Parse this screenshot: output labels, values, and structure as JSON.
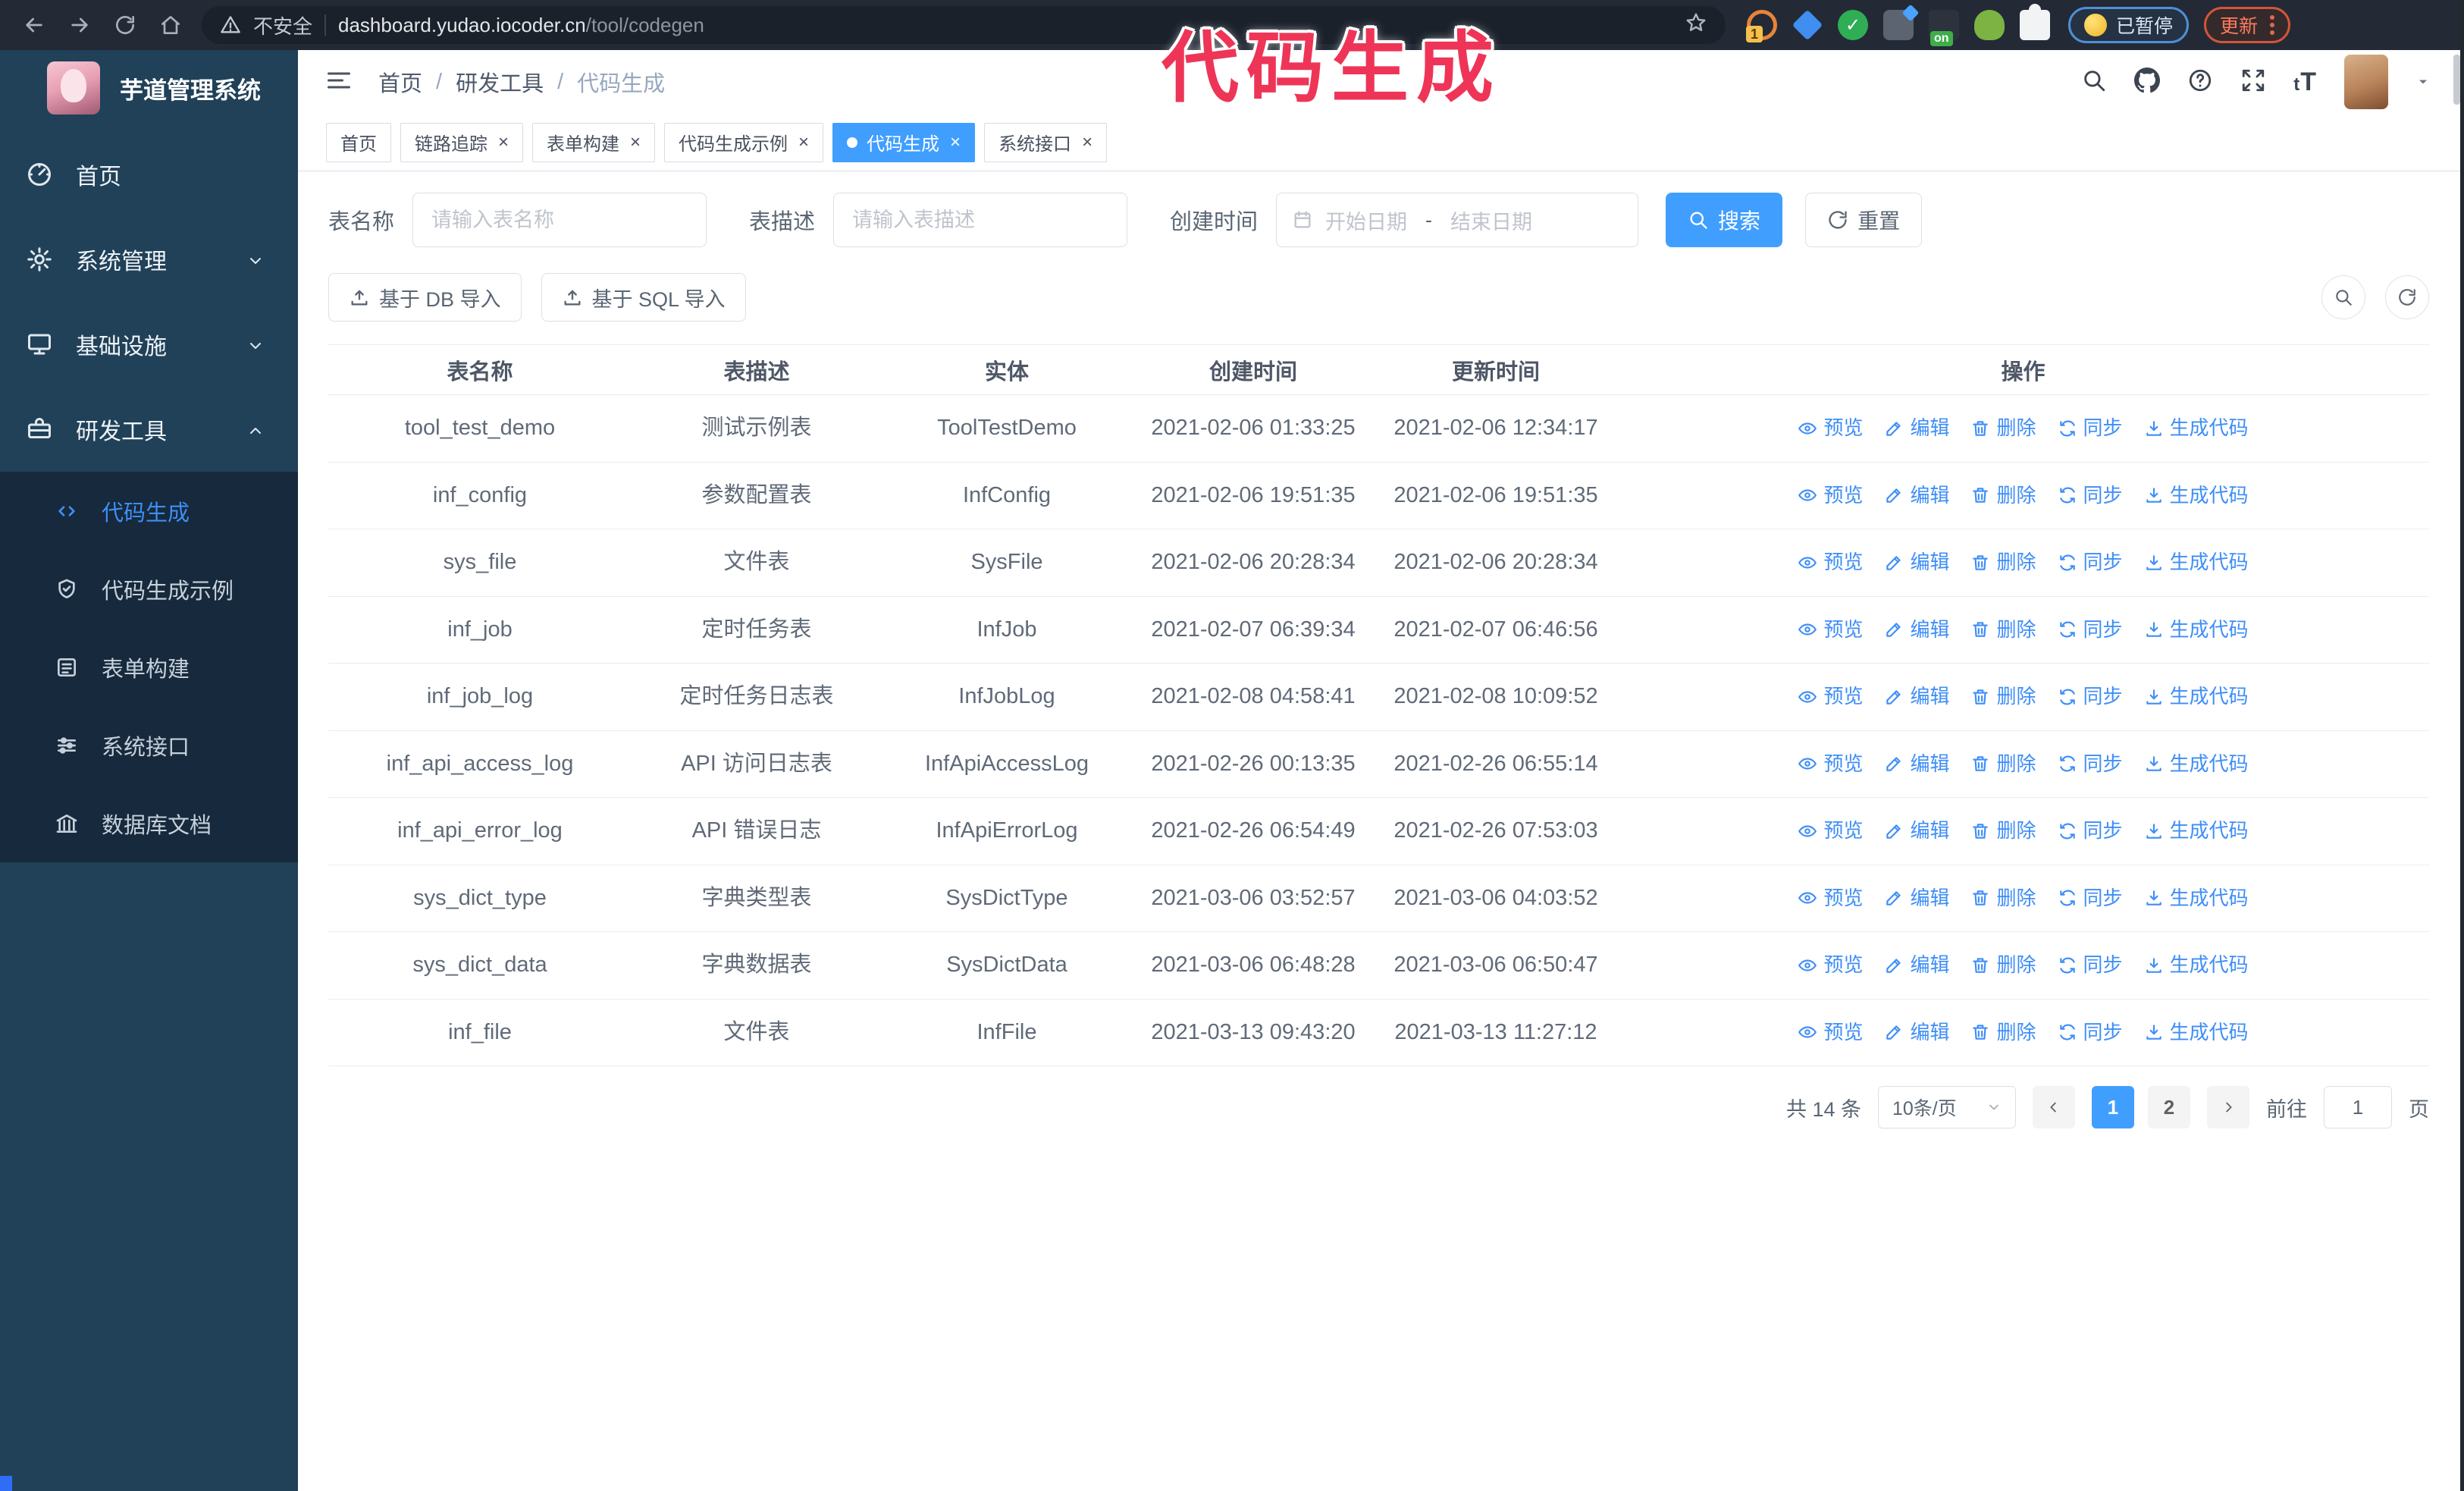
{
  "colors": {
    "accent": "#409eff",
    "annotation": "#ee3557",
    "sidebar_bg": "#204158",
    "submenu_bg": "#17293c",
    "update_accent": "#ff7a5c",
    "paused_border": "#4f8fd6"
  },
  "annotation": {
    "text": "代码生成"
  },
  "browser": {
    "security_label": "不安全",
    "url_host": "dashboard.yudao.iocoder.cn",
    "url_path": "/tool/codegen",
    "paused_label": "已暂停",
    "update_label": "更新",
    "extensions": [
      {
        "name": "orange-ring-extension",
        "type": "ring",
        "badge": "1"
      },
      {
        "name": "blue-gem-extension",
        "type": "gem"
      },
      {
        "name": "green-check-extension",
        "type": "check",
        "glyph": "✓"
      },
      {
        "name": "grid-extension",
        "type": "grid"
      },
      {
        "name": "screen-on-extension",
        "type": "onsw",
        "badge": "on"
      },
      {
        "name": "green-bot-extension",
        "type": "bot"
      },
      {
        "name": "puzzle-extension",
        "type": "puzzle"
      }
    ]
  },
  "sidebar": {
    "title": "芋道管理系统",
    "menu": [
      {
        "id": "home",
        "label": "首页",
        "icon": "gauge",
        "chevron": null,
        "active": false
      },
      {
        "id": "system",
        "label": "系统管理",
        "icon": "gear",
        "chevron": "down",
        "active": false
      },
      {
        "id": "infra",
        "label": "基础设施",
        "icon": "monitor",
        "chevron": "down",
        "active": false
      },
      {
        "id": "devtools",
        "label": "研发工具",
        "icon": "toolbox",
        "chevron": "up",
        "active": true
      }
    ],
    "submenu": [
      {
        "id": "codegen",
        "label": "代码生成",
        "icon": "code",
        "active": true
      },
      {
        "id": "codegen-example",
        "label": "代码生成示例",
        "icon": "shield",
        "active": false
      },
      {
        "id": "form-builder",
        "label": "表单构建",
        "icon": "form",
        "active": false
      },
      {
        "id": "system-api",
        "label": "系统接口",
        "icon": "sliders",
        "active": false
      },
      {
        "id": "db-doc",
        "label": "数据库文档",
        "icon": "db",
        "active": false
      }
    ]
  },
  "navbar": {
    "breadcrumb": [
      "首页",
      "研发工具",
      "代码生成"
    ],
    "separator": "/"
  },
  "tabs": [
    {
      "id": "home",
      "label": "首页",
      "closable": false,
      "active": false
    },
    {
      "id": "tracing",
      "label": "链路追踪",
      "closable": true,
      "active": false
    },
    {
      "id": "form-builder",
      "label": "表单构建",
      "closable": true,
      "active": false
    },
    {
      "id": "codegen-example",
      "label": "代码生成示例",
      "closable": true,
      "active": false
    },
    {
      "id": "codegen",
      "label": "代码生成",
      "closable": true,
      "active": true
    },
    {
      "id": "system-api",
      "label": "系统接口",
      "closable": true,
      "active": false
    }
  ],
  "filters": {
    "name_label": "表名称",
    "name_placeholder": "请输入表名称",
    "desc_label": "表描述",
    "desc_placeholder": "请输入表描述",
    "date_label": "创建时间",
    "start_placeholder": "开始日期",
    "range_separator": "-",
    "end_placeholder": "结束日期",
    "search_label": "搜索",
    "reset_label": "重置"
  },
  "toolbar": {
    "db_import_label": "基于 DB 导入",
    "sql_import_label": "基于 SQL 导入"
  },
  "table": {
    "columns": [
      "表名称",
      "表描述",
      "实体",
      "创建时间",
      "更新时间",
      "操作"
    ],
    "actions": [
      {
        "id": "preview",
        "label": "预览",
        "icon": "eye"
      },
      {
        "id": "edit",
        "label": "编辑",
        "icon": "edit"
      },
      {
        "id": "delete",
        "label": "删除",
        "icon": "delete"
      },
      {
        "id": "sync",
        "label": "同步",
        "icon": "sync"
      },
      {
        "id": "generate",
        "label": "生成代码",
        "icon": "download"
      }
    ],
    "rows": [
      {
        "name": "tool_test_demo",
        "desc": "测试示例表",
        "entity": "ToolTestDemo",
        "created": "2021-02-06 01:33:25",
        "updated": "2021-02-06 12:34:17"
      },
      {
        "name": "inf_config",
        "desc": "参数配置表",
        "entity": "InfConfig",
        "created": "2021-02-06 19:51:35",
        "updated": "2021-02-06 19:51:35"
      },
      {
        "name": "sys_file",
        "desc": "文件表",
        "entity": "SysFile",
        "created": "2021-02-06 20:28:34",
        "updated": "2021-02-06 20:28:34"
      },
      {
        "name": "inf_job",
        "desc": "定时任务表",
        "entity": "InfJob",
        "created": "2021-02-07 06:39:34",
        "updated": "2021-02-07 06:46:56"
      },
      {
        "name": "inf_job_log",
        "desc": "定时任务日志表",
        "entity": "InfJobLog",
        "created": "2021-02-08 04:58:41",
        "updated": "2021-02-08 10:09:52"
      },
      {
        "name": "inf_api_access_log",
        "desc": "API 访问日志表",
        "entity": "InfApiAccessLog",
        "created": "2021-02-26 00:13:35",
        "updated": "2021-02-26 06:55:14"
      },
      {
        "name": "inf_api_error_log",
        "desc": "API 错误日志",
        "entity": "InfApiErrorLog",
        "created": "2021-02-26 06:54:49",
        "updated": "2021-02-26 07:53:03"
      },
      {
        "name": "sys_dict_type",
        "desc": "字典类型表",
        "entity": "SysDictType",
        "created": "2021-03-06 03:52:57",
        "updated": "2021-03-06 04:03:52"
      },
      {
        "name": "sys_dict_data",
        "desc": "字典数据表",
        "entity": "SysDictData",
        "created": "2021-03-06 06:48:28",
        "updated": "2021-03-06 06:50:47"
      },
      {
        "name": "inf_file",
        "desc": "文件表",
        "entity": "InfFile",
        "created": "2021-03-13 09:43:20",
        "updated": "2021-03-13 11:27:12"
      }
    ]
  },
  "pagination": {
    "total_label": "共 14 条",
    "page_size_label": "10条/页",
    "pages": [
      "1",
      "2"
    ],
    "active_page": "1",
    "goto_label": "前往",
    "goto_value": "1",
    "page_unit": "页"
  }
}
